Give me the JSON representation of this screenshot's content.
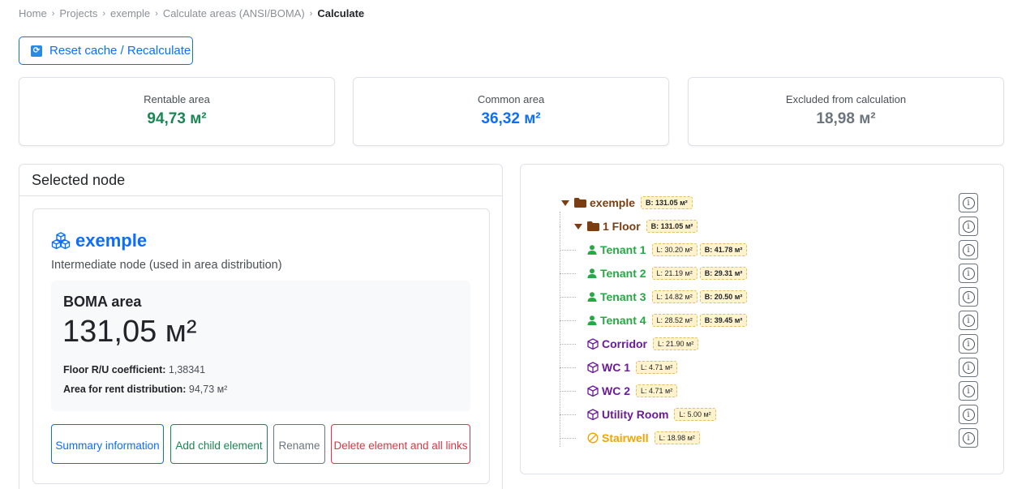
{
  "breadcrumb": {
    "items": [
      "Home",
      "Projects",
      "exemple",
      "Calculate areas (ANSI/BOMA)"
    ],
    "current": "Calculate"
  },
  "toolbar": {
    "reset_label": "Reset cache / Recalculate"
  },
  "stats": {
    "rentable": {
      "label": "Rentable area",
      "value": "94,73 м²",
      "color": "#198754"
    },
    "common": {
      "label": "Common area",
      "value": "36,32 м²",
      "color": "#0d6efd"
    },
    "excluded": {
      "label": "Excluded from calculation",
      "value": "18,98 м²",
      "color": "#6c757d"
    }
  },
  "selected": {
    "header": "Selected node",
    "name": "exemple",
    "subtitle": "Intermediate node (used in area distribution)",
    "boma_title": "BOMA area",
    "boma_value": "131,05 м²",
    "ru_label": "Floor R/U coefficient:",
    "ru_value": "1,38341",
    "rent_label": "Area for rent distribution:",
    "rent_value": "94,73 м²"
  },
  "actions": {
    "summary": "Summary information",
    "add_child": "Add child element",
    "rename": "Rename",
    "delete": "Delete element and all links"
  },
  "tree": {
    "root": {
      "label": "exemple",
      "badge": "B: 131.05 м²"
    },
    "floor": {
      "label": "1 Floor",
      "badge": "B: 131.05 м²"
    },
    "tenants": [
      {
        "label": "Tenant 1",
        "l": "L: 30.20 м²",
        "b": "B: 41.78 м²"
      },
      {
        "label": "Tenant 2",
        "l": "L: 21.19 м²",
        "b": "B: 29.31 м²"
      },
      {
        "label": "Tenant 3",
        "l": "L: 14.82 м²",
        "b": "B: 20.50 м²"
      },
      {
        "label": "Tenant 4",
        "l": "L: 28.52 м²",
        "b": "B: 39.45 м²"
      }
    ],
    "common": [
      {
        "label": "Corridor",
        "l": "L: 21.90 м²"
      },
      {
        "label": "WC 1",
        "l": "L: 4.71 м²"
      },
      {
        "label": "WC 2",
        "l": "L: 4.71 м²"
      },
      {
        "label": "Utility Room",
        "l": "L: 5.00 м²"
      }
    ],
    "excluded": [
      {
        "label": "Stairwell",
        "l": "L: 18.98 м²"
      }
    ],
    "colors": {
      "folder": "#7a3e12",
      "tenant": "#28a745",
      "common": "#6a1b9a",
      "excluded": "#f0a500"
    }
  }
}
